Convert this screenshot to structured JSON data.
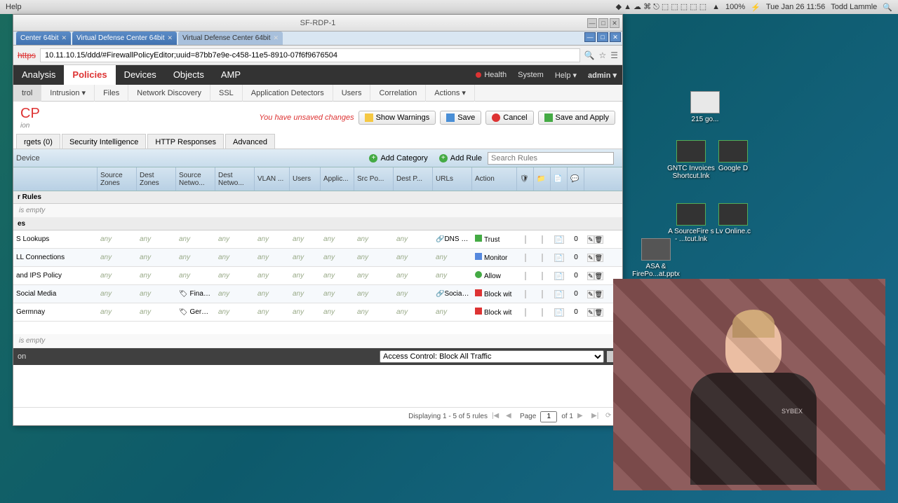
{
  "mac": {
    "help": "Help",
    "battery": "100%",
    "batt_icon": "⚡",
    "date": "Tue Jan 26  11:56",
    "user": "Todd Lammle"
  },
  "rdp": {
    "title": "SF-RDP-1"
  },
  "tabs": [
    {
      "label": "Center 64bit"
    },
    {
      "label": "Virtual Defense Center 64bit"
    },
    {
      "label": "Virtual Defense Center 64bit"
    }
  ],
  "url": "10.11.10.15/ddd/#FirewallPolicyEditor;uuid=87bb7e9e-c458-11e5-8910-07f6f9676504",
  "url_scheme": "https",
  "nav": {
    "analysis": "Analysis",
    "policies": "Policies",
    "devices": "Devices",
    "objects": "Objects",
    "amp": "AMP",
    "health": "Health",
    "system": "System",
    "help": "Help ▾",
    "admin": "admin ▾"
  },
  "subnav": [
    "trol",
    "Intrusion ▾",
    "Files",
    "Network Discovery",
    "SSL",
    "Application Detectors",
    "Users",
    "Correlation",
    "Actions ▾"
  ],
  "policy": {
    "title": "CP",
    "desc": "ion",
    "unsaved": "You have unsaved changes",
    "show_warnings": "Show Warnings",
    "save": "Save",
    "cancel": "Cancel",
    "save_apply": "Save and Apply"
  },
  "ptabs": [
    "rgets (0)",
    "Security Intelligence",
    "HTTP Responses",
    "Advanced"
  ],
  "toolbar": {
    "device": "Device",
    "add_category": "Add Category",
    "add_rule": "Add Rule",
    "search_ph": "Search Rules"
  },
  "cols": [
    "",
    "Source Zones",
    "Dest Zones",
    "Source Netwo...",
    "Dest Netwo...",
    "VLAN ...",
    "Users",
    "Applic...",
    "Src Po...",
    "Dest P...",
    "URLs",
    "Action"
  ],
  "section1": "r Rules",
  "empty_text": "is empty",
  "section2": "es",
  "rules": [
    {
      "name": "S Lookups",
      "sz": "any",
      "dz": "any",
      "sn": "any",
      "dn": "any",
      "vlan": "any",
      "users": "any",
      "app": "any",
      "sp": "any",
      "dp": "any",
      "urls": "DNS ove",
      "urls_any": "any",
      "action": "Trust",
      "aclass": "ai-trust",
      "flag1": "",
      "flag2": "",
      "count": "0"
    },
    {
      "name": "LL Connections",
      "sz": "any",
      "dz": "any",
      "sn": "any",
      "dn": "any",
      "vlan": "any",
      "users": "any",
      "app": "any",
      "sp": "any",
      "dp": "any",
      "urls": "",
      "urls_any": "any",
      "action": "Monitor",
      "aclass": "ai-monitor",
      "flag1": "",
      "flag2": "",
      "count": "0"
    },
    {
      "name": "and IPS Policy",
      "sz": "any",
      "dz": "any",
      "sn": "any",
      "dn": "any",
      "vlan": "any",
      "users": "any",
      "app": "any",
      "sp": "any",
      "dp": "any",
      "urls": "",
      "urls_any": "any",
      "action": "Allow",
      "aclass": "ai-allow",
      "flag1": "y",
      "flag2": "y",
      "count": "0"
    },
    {
      "name": "Social Media",
      "sz": "any",
      "dz": "any",
      "sn": "Finance",
      "dn": "any",
      "vlan": "any",
      "users": "any",
      "app": "any",
      "sp": "any",
      "dp": "any",
      "urls": "Social Netw",
      "urls_any": "",
      "action": "Block wit",
      "aclass": "ai-block",
      "flag1": "",
      "flag2": "",
      "count": "0"
    },
    {
      "name": "Germnay",
      "sz": "any",
      "dz": "any",
      "sn": "Germany",
      "dn": "any",
      "vlan": "any",
      "users": "any",
      "app": "any",
      "sp": "any",
      "dp": "any",
      "urls": "",
      "urls_any": "any",
      "action": "Block wit",
      "aclass": "ai-block",
      "flag1": "",
      "flag2": "",
      "count": "0"
    }
  ],
  "default_action_label": "on",
  "default_action": "Access Control: Block All Traffic",
  "footer": {
    "display": "Displaying 1 - 5 of 5 rules",
    "page": "Page",
    "page_num": "1",
    "of": "of 1"
  },
  "desk": {
    "d1": "215 go...",
    "d2": "GNTC Invoices Shortcut.lnk",
    "d3": "Google D",
    "d4": "A SourceFire s - ...tcut.lnk",
    "d5": "Lv Online.c",
    "d6": "ASA & FirePo...at.pptx"
  },
  "logo": "SYBEX"
}
